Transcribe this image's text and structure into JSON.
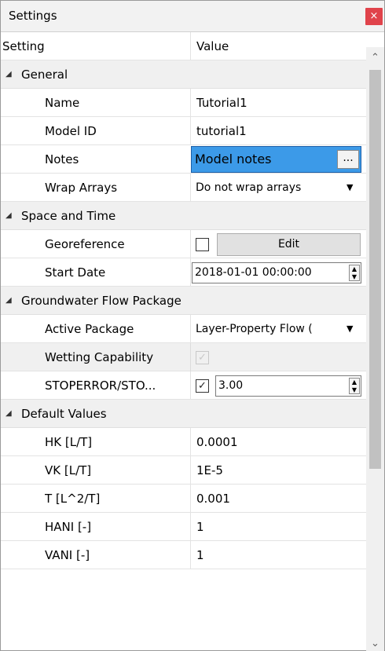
{
  "window": {
    "title": "Settings",
    "close_glyph": "×"
  },
  "columns": {
    "setting": "Setting",
    "value": "Value"
  },
  "categories": {
    "general": "General",
    "space_time": "Space and Time",
    "gw_flow": "Groundwater Flow Package",
    "defaults": "Default Values"
  },
  "rows": {
    "name": {
      "label": "Name",
      "value": "Tutorial1"
    },
    "model_id": {
      "label": "Model ID",
      "value": "tutorial1"
    },
    "notes": {
      "label": "Notes",
      "value": "Model notes",
      "button": "..."
    },
    "wrap_arrays": {
      "label": "Wrap Arrays",
      "value": "Do not wrap arrays"
    },
    "georeference": {
      "label": "Georeference",
      "checked": false,
      "button": "Edit"
    },
    "start_date": {
      "label": "Start Date",
      "value": "2018-01-01 00:00:00"
    },
    "active_package": {
      "label": "Active Package",
      "value": "Layer-Property Flow ("
    },
    "wetting": {
      "label": "Wetting Capability",
      "checked": true,
      "enabled": false
    },
    "stoperror": {
      "label": "STOPERROR/STO...",
      "checked": true,
      "value": "3.00"
    },
    "hk": {
      "label": "HK [L/T]",
      "value": "0.0001"
    },
    "vk": {
      "label": "VK [L/T]",
      "value": "1E-5"
    },
    "t": {
      "label": "T [L^2/T]",
      "value": "0.001"
    },
    "hani": {
      "label": "HANI [-]",
      "value": "1"
    },
    "vani": {
      "label": "VANI [-]",
      "value": "1"
    }
  },
  "glyphs": {
    "expanded_triangle": "◢",
    "combo_arrow": "▼",
    "check": "✓",
    "spin_up": "▲",
    "spin_down": "▼",
    "scroll_up": "⌃",
    "scroll_down": "⌄"
  },
  "colors": {
    "selected_editor": "#3c9ae8",
    "close_button": "#e0434b",
    "category_bg": "#f0f0f0"
  }
}
